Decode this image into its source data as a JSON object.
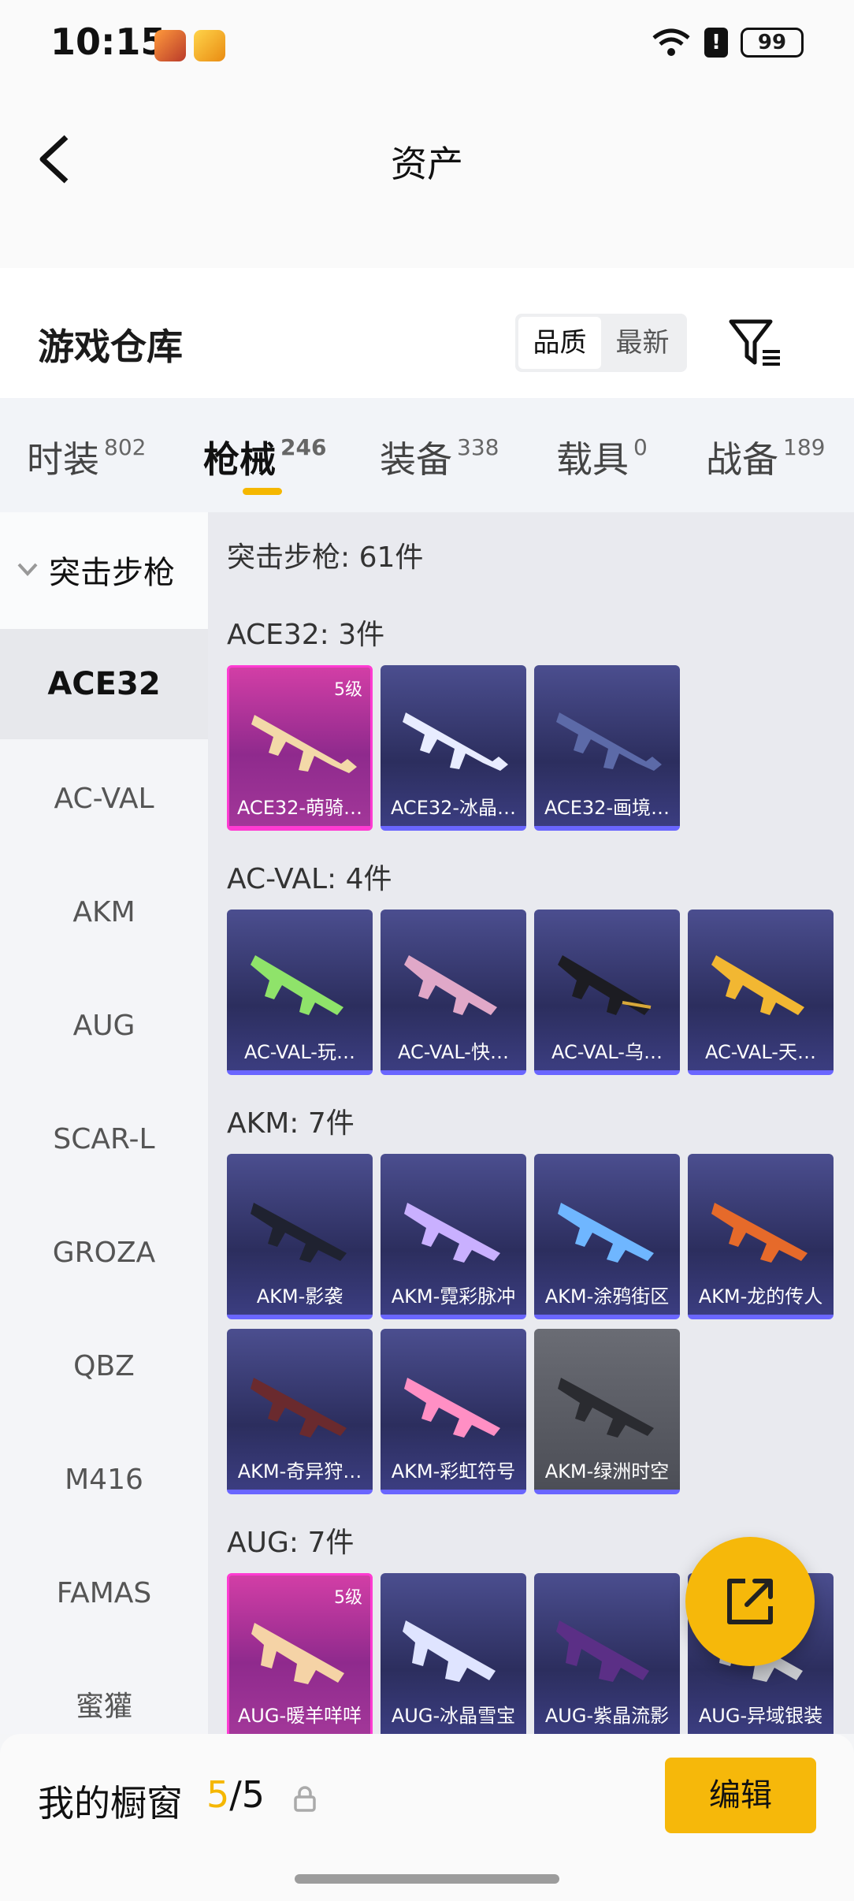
{
  "status_bar": {
    "time": "10:15",
    "battery": "99",
    "alert": "!"
  },
  "header": {
    "title": "资产"
  },
  "warehouse": {
    "title": "游戏仓库",
    "sort_options": [
      "品质",
      "最新"
    ]
  },
  "tabs": [
    {
      "label": "时装",
      "count": "802"
    },
    {
      "label": "枪械",
      "count": "246"
    },
    {
      "label": "装备",
      "count": "338"
    },
    {
      "label": "载具",
      "count": "0"
    },
    {
      "label": "战备",
      "count": "189"
    }
  ],
  "sidebar": {
    "category": "突击步枪",
    "items": [
      "ACE32",
      "AC-VAL",
      "AKM",
      "AUG",
      "SCAR-L",
      "GROZA",
      "QBZ",
      "M416",
      "FAMAS",
      "蜜獾"
    ]
  },
  "content": {
    "total": "突击步枪: 61件",
    "groups": [
      {
        "title": "ACE32: 3件",
        "items": [
          {
            "name": "ACE32-萌骑…",
            "level": "5级",
            "rarity": "legendary"
          },
          {
            "name": "ACE32-冰晶…",
            "rarity": "epic"
          },
          {
            "name": "ACE32-画境…",
            "rarity": "epic"
          }
        ]
      },
      {
        "title": "AC-VAL: 4件",
        "items": [
          {
            "name": "AC-VAL-玩…",
            "rarity": "epic"
          },
          {
            "name": "AC-VAL-快…",
            "rarity": "epic"
          },
          {
            "name": "AC-VAL-乌…",
            "rarity": "epic"
          },
          {
            "name": "AC-VAL-天…",
            "rarity": "epic"
          }
        ]
      },
      {
        "title": "AKM: 7件",
        "items": [
          {
            "name": "AKM-影袭",
            "rarity": "epic"
          },
          {
            "name": "AKM-霓彩脉冲",
            "rarity": "epic"
          },
          {
            "name": "AKM-涂鸦街区",
            "rarity": "epic"
          },
          {
            "name": "AKM-龙的传人",
            "rarity": "epic"
          },
          {
            "name": "AKM-奇异狩…",
            "rarity": "epic"
          },
          {
            "name": "AKM-彩虹符号",
            "rarity": "epic"
          },
          {
            "name": "AKM-绿洲时空",
            "rarity": "common"
          }
        ]
      },
      {
        "title": "AUG: 7件",
        "items": [
          {
            "name": "AUG-暖羊咩咩",
            "level": "5级",
            "rarity": "legendary"
          },
          {
            "name": "AUG-冰晶雪宝",
            "rarity": "epic"
          },
          {
            "name": "AUG-紫晶流影",
            "rarity": "epic"
          },
          {
            "name": "AUG-异域银装",
            "rarity": "epic"
          }
        ]
      }
    ]
  },
  "bottom": {
    "label": "我的橱窗",
    "current": "5",
    "total": "/5",
    "edit": "编辑"
  },
  "colors": {
    "accent": "#f6b80a",
    "legendary": "#ff3bd2",
    "epic": "#6a66ff"
  }
}
